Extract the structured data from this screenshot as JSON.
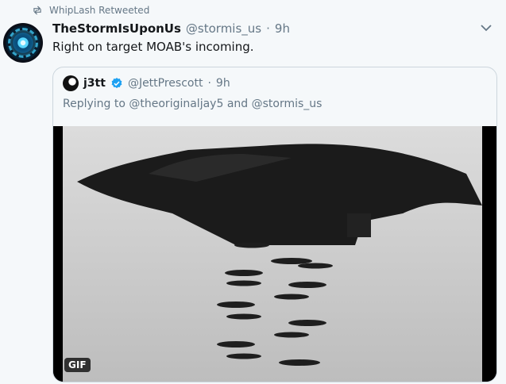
{
  "retweet": {
    "label": "WhipLash Retweeted",
    "icon": "retweet-icon"
  },
  "tweet": {
    "display_name": "TheStormIsUponUs",
    "handle": "@stormis_us",
    "separator": "·",
    "time": "9h",
    "text": "Right on target MOAB's incoming.",
    "menu_icon": "chevron-down-icon"
  },
  "quote": {
    "display_name": "j3tt",
    "verified_icon": "verified-badge-icon",
    "handle": "@JettPrescott",
    "separator": "·",
    "time": "9h",
    "reply_prefix": "Replying to",
    "reply_mention_1": "@theoriginaljay5",
    "reply_and": "and",
    "reply_mention_2": "@stormis_us",
    "media_badge": "GIF"
  },
  "colors": {
    "background": "#f5f8fa",
    "secondary_text": "#657786",
    "verified_blue": "#1da1f2",
    "border": "#ccd6dd"
  }
}
